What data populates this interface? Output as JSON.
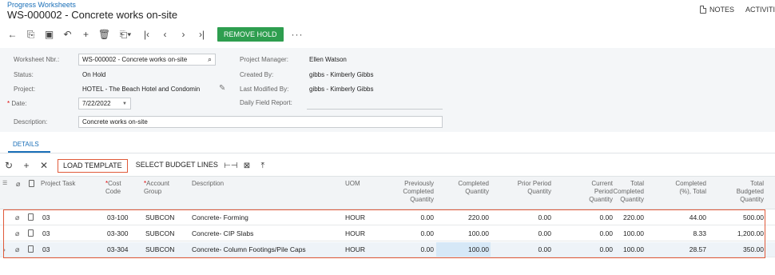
{
  "header": {
    "breadcrumb": "Progress Worksheets",
    "title": "WS-000002 - Concrete works on-site",
    "notes_label": "NOTES",
    "activities_label": "ACTIVITI"
  },
  "toolbar": {
    "remove_hold_label": "REMOVE HOLD",
    "more_label": "···"
  },
  "form": {
    "worksheet_nbr_label": "Worksheet Nbr.:",
    "worksheet_nbr_value": "WS-000002 - Concrete works on-site",
    "status_label": "Status:",
    "status_value": "On Hold",
    "project_label": "Project:",
    "project_value": "HOTEL - The Beach Hotel and Condomin",
    "date_label": "Date:",
    "date_value": "7/22/2022",
    "description_label": "Description:",
    "description_value": "Concrete works on-site",
    "project_manager_label": "Project Manager:",
    "project_manager_value": "Ellen Watson",
    "created_by_label": "Created By:",
    "created_by_value": "gibbs - Kimberly Gibbs",
    "last_modified_label": "Last Modified By:",
    "last_modified_value": "gibbs - Kimberly Gibbs",
    "daily_field_report_label": "Daily Field Report:",
    "daily_field_report_value": ""
  },
  "tabs": [
    {
      "label": "DETAILS"
    }
  ],
  "grid_toolbar": {
    "load_template_label": "LOAD TEMPLATE",
    "select_budget_lines_label": "SELECT BUDGET LINES"
  },
  "columns": {
    "project_task": "Project Task",
    "cost_code": [
      "Cost",
      "Code"
    ],
    "account_group": [
      "Account",
      "Group"
    ],
    "description": "Description",
    "uom": "UOM",
    "previously_completed": [
      "Previously",
      "Completed",
      "Quantity"
    ],
    "completed_quantity": [
      "Completed",
      "Quantity"
    ],
    "prior_period_quantity": [
      "Prior Period",
      "Quantity"
    ],
    "current_period_quantity": [
      "Current",
      "Period",
      "Quantity"
    ],
    "total_completed_quantity": [
      "Total",
      "Completed",
      "Quantity"
    ],
    "completed_pct_total": [
      "Completed",
      "(%), Total"
    ],
    "total_budgeted_quantity": [
      "Total",
      "Budgeted",
      "Quantity"
    ]
  },
  "rows": [
    {
      "task": "03",
      "cost_code": "03-100",
      "account_group": "SUBCON",
      "description": "Concrete- Forming",
      "uom": "HOUR",
      "prev": "0.00",
      "completed": "220.00",
      "prior": "0.00",
      "current": "0.00",
      "total_completed": "220.00",
      "pct": "44.00",
      "budgeted": "500.00"
    },
    {
      "task": "03",
      "cost_code": "03-300",
      "account_group": "SUBCON",
      "description": "Concrete- CIP Slabs",
      "uom": "HOUR",
      "prev": "0.00",
      "completed": "100.00",
      "prior": "0.00",
      "current": "0.00",
      "total_completed": "100.00",
      "pct": "8.33",
      "budgeted": "1,200.00"
    },
    {
      "task": "03",
      "cost_code": "03-304",
      "account_group": "SUBCON",
      "description": "Concrete- Column Footings/Pile Caps",
      "uom": "HOUR",
      "prev": "0.00",
      "completed": "100.00",
      "prior": "0.00",
      "current": "0.00",
      "total_completed": "100.00",
      "pct": "28.57",
      "budgeted": "350.00"
    }
  ]
}
